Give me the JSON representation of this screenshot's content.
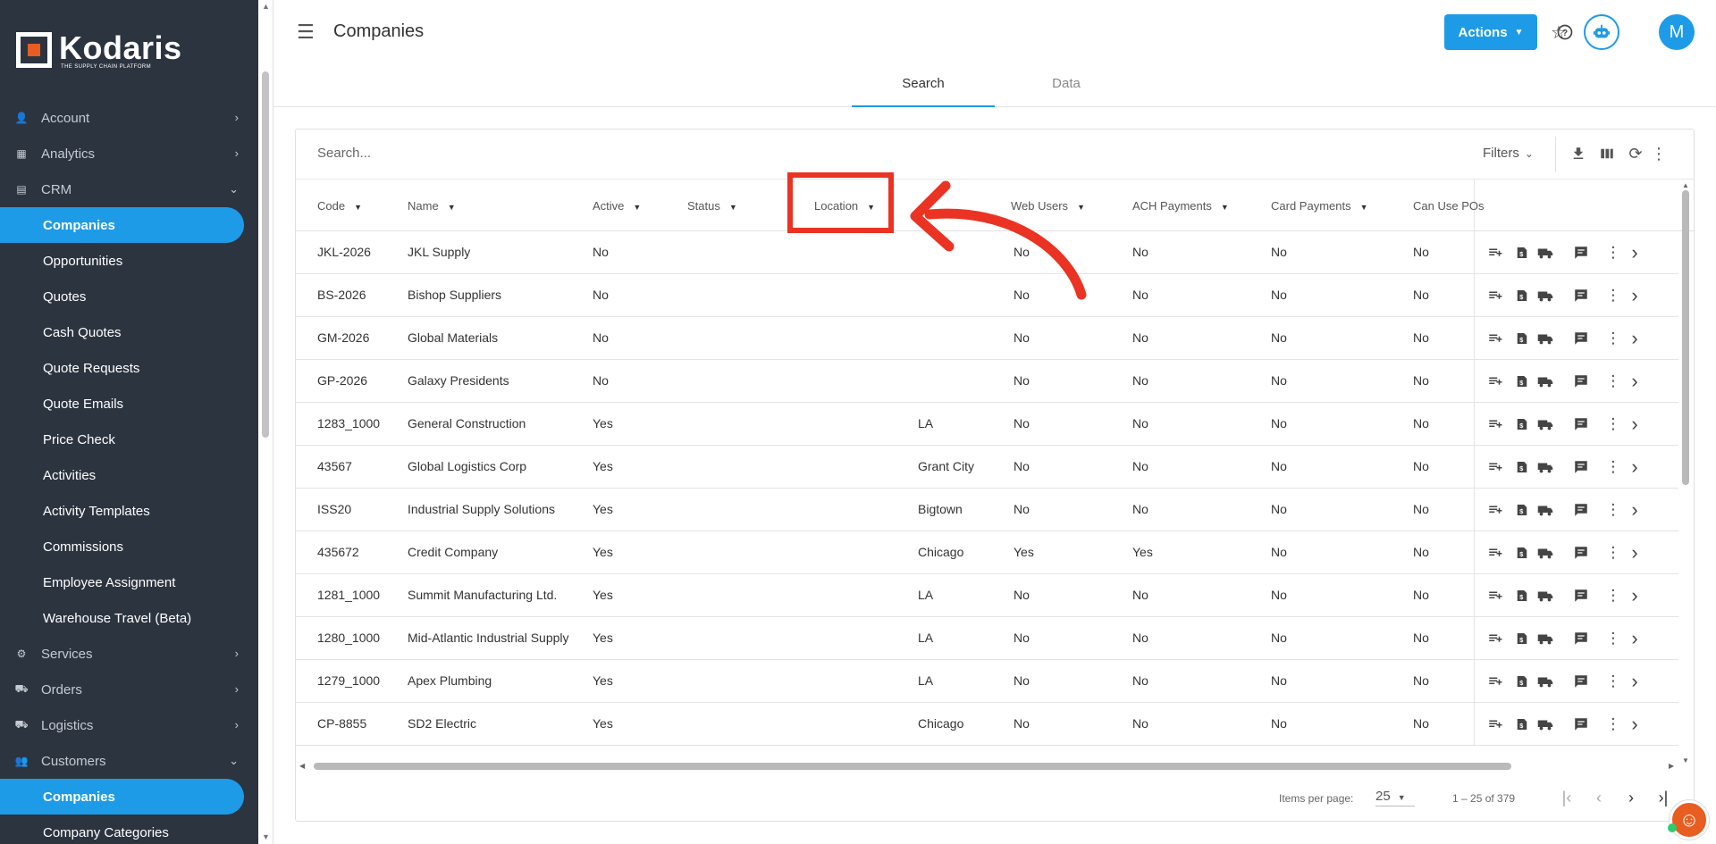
{
  "brand": {
    "name": "Kodaris",
    "tagline": "THE SUPPLY CHAIN PLATFORM"
  },
  "sidebar": {
    "items": [
      {
        "label": "Account",
        "type": "group",
        "icon": "account-icon",
        "chevron": "›"
      },
      {
        "label": "Analytics",
        "type": "group",
        "icon": "analytics-icon",
        "chevron": "›"
      },
      {
        "label": "CRM",
        "type": "group",
        "icon": "crm-icon",
        "chevron": "⌄"
      },
      {
        "label": "Companies",
        "type": "sub",
        "active": true
      },
      {
        "label": "Opportunities",
        "type": "sub"
      },
      {
        "label": "Quotes",
        "type": "sub"
      },
      {
        "label": "Cash Quotes",
        "type": "sub"
      },
      {
        "label": "Quote Requests",
        "type": "sub"
      },
      {
        "label": "Quote Emails",
        "type": "sub"
      },
      {
        "label": "Price Check",
        "type": "sub"
      },
      {
        "label": "Activities",
        "type": "sub"
      },
      {
        "label": "Activity Templates",
        "type": "sub"
      },
      {
        "label": "Commissions",
        "type": "sub"
      },
      {
        "label": "Employee Assignment",
        "type": "sub"
      },
      {
        "label": "Warehouse Travel (Beta)",
        "type": "sub"
      },
      {
        "label": "Services",
        "type": "group",
        "icon": "services-icon",
        "chevron": "›"
      },
      {
        "label": "Orders",
        "type": "group",
        "icon": "orders-icon",
        "chevron": "›"
      },
      {
        "label": "Logistics",
        "type": "group",
        "icon": "logistics-icon",
        "chevron": "›"
      },
      {
        "label": "Customers",
        "type": "group",
        "icon": "customers-icon",
        "chevron": "⌄"
      },
      {
        "label": "Companies",
        "type": "sub",
        "active": true
      },
      {
        "label": "Company Categories",
        "type": "sub"
      }
    ]
  },
  "header": {
    "title": "Companies",
    "actions_label": "Actions",
    "avatar_initial": "M",
    "tabs": [
      {
        "label": "Search",
        "active": true
      },
      {
        "label": "Data",
        "active": false
      }
    ]
  },
  "toolbar": {
    "search_placeholder": "Search...",
    "filters_label": "Filters"
  },
  "table": {
    "columns": [
      {
        "label": "Code"
      },
      {
        "label": "Name"
      },
      {
        "label": "Active"
      },
      {
        "label": "Status"
      },
      {
        "label": "Location"
      },
      {
        "label": ""
      },
      {
        "label": "Web Users"
      },
      {
        "label": "ACH Payments"
      },
      {
        "label": "Card Payments"
      },
      {
        "label": "Can Use POs"
      }
    ],
    "rows": [
      {
        "code": "JKL-2026",
        "name": "JKL Supply",
        "active": "No",
        "city": "",
        "web": "No",
        "ach": "No",
        "card": "No",
        "po": "No"
      },
      {
        "code": "BS-2026",
        "name": "Bishop Suppliers",
        "active": "No",
        "city": "",
        "web": "No",
        "ach": "No",
        "card": "No",
        "po": "No"
      },
      {
        "code": "GM-2026",
        "name": "Global Materials",
        "active": "No",
        "city": "",
        "web": "No",
        "ach": "No",
        "card": "No",
        "po": "No"
      },
      {
        "code": "GP-2026",
        "name": "Galaxy Presidents",
        "active": "No",
        "city": "",
        "web": "No",
        "ach": "No",
        "card": "No",
        "po": "No"
      },
      {
        "code": "1283_1000",
        "name": "General Construction",
        "active": "Yes",
        "city": "LA",
        "web": "No",
        "ach": "No",
        "card": "No",
        "po": "No"
      },
      {
        "code": "43567",
        "name": "Global Logistics Corp",
        "active": "Yes",
        "city": "Grant City",
        "web": "No",
        "ach": "No",
        "card": "No",
        "po": "No"
      },
      {
        "code": "ISS20",
        "name": "Industrial Supply Solutions",
        "active": "Yes",
        "city": "Bigtown",
        "web": "No",
        "ach": "No",
        "card": "No",
        "po": "No"
      },
      {
        "code": "435672",
        "name": "Credit Company",
        "active": "Yes",
        "city": "Chicago",
        "web": "Yes",
        "ach": "Yes",
        "card": "No",
        "po": "No"
      },
      {
        "code": "1281_1000",
        "name": "Summit Manufacturing Ltd.",
        "active": "Yes",
        "city": "LA",
        "web": "No",
        "ach": "No",
        "card": "No",
        "po": "No"
      },
      {
        "code": "1280_1000",
        "name": "Mid-Atlantic Industrial Supply",
        "active": "Yes",
        "city": "LA",
        "web": "No",
        "ach": "No",
        "card": "No",
        "po": "No"
      },
      {
        "code": "1279_1000",
        "name": "Apex Plumbing",
        "active": "Yes",
        "city": "LA",
        "web": "No",
        "ach": "No",
        "card": "No",
        "po": "No"
      },
      {
        "code": "CP-8855",
        "name": "SD2 Electric",
        "active": "Yes",
        "city": "Chicago",
        "web": "No",
        "ach": "No",
        "card": "No",
        "po": "No"
      }
    ]
  },
  "pager": {
    "items_per_page_label": "Items per page:",
    "items_per_page": "25",
    "range": "1 – 25 of 379"
  },
  "annotation": {
    "highlight_color": "#ea3323"
  },
  "colors": {
    "accent": "#1e9be6",
    "sidebar": "#2c3440",
    "brand_orange": "#e85d20"
  }
}
